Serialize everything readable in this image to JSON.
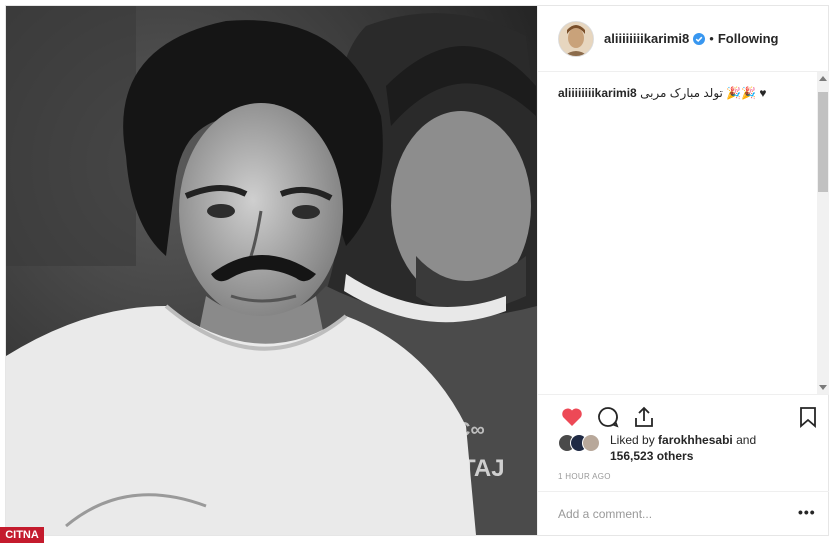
{
  "post": {
    "username": "aliiiiiiiikarimi8",
    "follow_status": "Following",
    "separator": "•",
    "caption_user": "aliiiiiiiikarimi8",
    "caption_text": "♥ 🎉🎉 تولد مبارک مربی",
    "cut_text": "...............",
    "liked_prefix": "Liked by",
    "liked_user": "farokhhesabi",
    "liked_and": "and",
    "liked_others": "156,523 others",
    "time": "1 HOUR AGO",
    "comment_placeholder": "Add a comment...",
    "more_label": "•••",
    "watermark": "CITNA"
  },
  "icons": {
    "verified": "verified-badge-icon",
    "like": "heart-filled-icon",
    "comment": "comment-bubble-icon",
    "share": "share-arrow-icon",
    "save": "bookmark-icon"
  },
  "colors": {
    "like_red": "#ed4956",
    "verified_blue": "#3897f0",
    "watermark_red": "#c41b2d"
  }
}
